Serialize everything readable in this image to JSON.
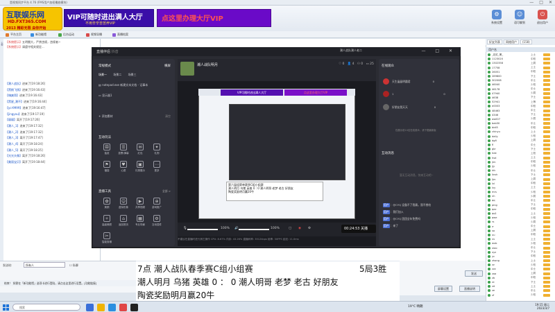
{
  "window": {
    "title": "是视频同步平台 4.76 (FMS用户加权播放模块)",
    "controls": [
      "—",
      "□",
      "✕"
    ]
  },
  "logo": {
    "line1": "互联娱乐网",
    "line2": "HD.FXT365.COM",
    "line3": "2013 精彩无限 由你开始"
  },
  "ads": {
    "ad1_main": "VIP可随时进出满人大厅",
    "ad1_sub": "不用辛辛苦苦养VIP",
    "ad2_main": "点这里办理大厅VIP",
    "ad2_sub": ""
  },
  "top_icons": [
    {
      "label": "系统设置",
      "icon": "⚙"
    },
    {
      "label": "语可聊到",
      "icon": "☺"
    },
    {
      "label": "退出用户",
      "icon": "⏻"
    }
  ],
  "toolbar": [
    "平台主页",
    "新功能馆",
    "后台运动",
    "视频导播",
    "直播档案"
  ],
  "chat_lines": [
    {
      "name": "【系统提示】",
      "text": "五明圈大，严禁违规，违规者~"
    },
    {
      "name": "【系统提示】",
      "text": "请遵守相关规定..."
    },
    {
      "name": "【潮人战队】",
      "text": "进来了[19:18:26]"
    },
    {
      "name": "【黑桃飞扬】",
      "text": "进来了[19:16:43]"
    },
    {
      "name": "【嗨爽哥】",
      "text": "进来了[19:16:43]"
    },
    {
      "name": "【黑星_潮不】",
      "text": "进来了[19:16:44]"
    },
    {
      "name": "【ycr9999】",
      "text": "进来了[19:16:47]"
    },
    {
      "name": "【jingyou】",
      "text": "进来了[19:17:19]"
    },
    {
      "name": "【弱弱】",
      "text": "离开了[19:17:26]"
    },
    {
      "name": "【潮人_1】",
      "text": "进来了[19:17:32]"
    },
    {
      "name": "【潮人_2】",
      "text": "进来了[19:17:32]"
    },
    {
      "name": "【潮人_3】",
      "text": "离开了[19:17:47]"
    },
    {
      "name": "【潮人_4】",
      "text": "离开了[19:18:24]"
    },
    {
      "name": "【潮人_5】",
      "text": "离开了[19:18:25]"
    },
    {
      "name": "【光光头像】",
      "text": "离开了[19:18:26]"
    },
    {
      "name": "【美丽宝贝】",
      "text": "离开了[19:18:44]"
    }
  ],
  "obs": {
    "title": "直播伴侣",
    "sub": "抖音",
    "user_label": "潮人战队潮人老二",
    "left": {
      "mode": "常规模式",
      "mode_side": "横屏",
      "scene_tabs": [
        "场景一",
        "场景二",
        "场景三"
      ],
      "sources": [
        "notepad.exe 新建文本文档 - 记事本",
        "显示器1"
      ],
      "add_source": "添加素材",
      "add_right": "清空",
      "section1": "互动玩法",
      "items1": [
        "抽奖",
        "投票/弹幕",
        "红包",
        "礼物",
        "福袋",
        "心愿",
        "礼物展示",
        "更多"
      ],
      "section2": "直播工具",
      "more": "全部 >",
      "items2": [
        "美颜",
        "虚拟形象",
        "共享视频",
        "游戏推广",
        "高级美颜",
        "返回首页",
        "专业场景",
        "互动插件",
        "智能剪辑"
      ]
    },
    "preview": {
      "name": "潮人战队明月",
      "stats": [
        "♡ 0",
        "👤 4",
        "⚇ 0",
        "▭ 25"
      ],
      "caption": [
        "第六届组第单赛季C组小组赛",
        "潮人明月 乌猪 英雄  0 : 0 潮人明哥 老梦 老古 好朋友",
        "陶瓷奖励明月赢20牛"
      ]
    },
    "controls": {
      "mic": "100%",
      "speaker": "100%",
      "timer": "00:24:53 关播"
    },
    "status": "不建议在直播时进行其它操作     CPU: 8.67%   内存: 43.26%   直播码率: 3512kbps   帧率: 30FPS   延迟: 11.0ms",
    "right": {
      "online_title": "在线观众",
      "online_users": [
        {
          "name": "天生晶晶明圆君",
          "score": "0"
        },
        {
          "name": "1",
          "score": "0"
        },
        {
          "name": "好朋友我天天",
          "score": "0"
        }
      ],
      "online_note": "仅展示前10名在线观众，请下载最新版",
      "interact_title": "互动消息",
      "empty": "暂无互动消息，快来互动吧~",
      "msgs": [
        {
          "tag": "用户",
          "text": "：@CYQ 设备不了我康。我不想给"
        },
        {
          "tag": "用户",
          "text": "：我们加入"
        },
        {
          "tag": "用户",
          "text": "：@CYQ 团团全年免费吗"
        },
        {
          "tag": "用户",
          "text": "：来了"
        }
      ]
    }
  },
  "overlay": {
    "line1": "7点          潮人战队春季赛C组小组赛",
    "line1b": "5局3胜",
    "line2": "潮人明月 乌猪 英雄  0 ：  0  潮人明哥 老梦 老古 好朋友",
    "line3": "陶瓷奖励明月赢20牛"
  },
  "input": {
    "label": "发送给:",
    "value": "所有人",
    "chk": "私聊",
    "hint": "结束！ 如需在「新功能馆」选项卡进行登陆，请点击这里进行设置。[功能链接]",
    "send": "发送"
  },
  "bottom_buttons": [
    "屏幕设置",
    "直播说明"
  ],
  "right_tabs": [
    "好友列表",
    "网络用户",
    "(158)"
  ],
  "right_head": "用户名",
  "users": [
    {
      "n": "_花红_黑_",
      "l": "上士"
    },
    {
      "n": "1123020",
      "l": "中校"
    },
    {
      "n": "1302358",
      "l": "上尉"
    },
    {
      "n": "17758",
      "l": "上士"
    },
    {
      "n": "26051",
      "l": "中校"
    },
    {
      "n": "289800",
      "l": "下士"
    },
    {
      "n": "302008",
      "l": "中士"
    },
    {
      "n": "46040",
      "l": "少校"
    },
    {
      "n": "46178",
      "l": "中士"
    },
    {
      "n": "47940",
      "l": "少尉"
    },
    {
      "n": "4638",
      "l": "下士"
    },
    {
      "n": "52941",
      "l": "上等"
    },
    {
      "n": "e0003",
      "l": "中校"
    },
    {
      "n": "48463",
      "l": "中士"
    },
    {
      "n": "4346",
      "l": "下士"
    },
    {
      "n": "aw007",
      "l": "少尉"
    },
    {
      "n": "bab30",
      "l": "中士"
    },
    {
      "n": "bidi5",
      "l": "中校"
    },
    {
      "n": "chinyu",
      "l": "上士"
    },
    {
      "n": "daily",
      "l": "少校"
    },
    {
      "n": "dgfi",
      "l": "上尉"
    },
    {
      "n": "fl",
      "l": "中士"
    },
    {
      "n": "gkr",
      "l": "下士"
    },
    {
      "n": "hde",
      "l": "上校"
    },
    {
      "n": "hsd",
      "l": "上士"
    },
    {
      "n": "jim",
      "l": "中校"
    },
    {
      "n": "jjy",
      "l": "少校"
    },
    {
      "n": "kfc",
      "l": "中士"
    },
    {
      "n": "linsh",
      "l": "下士"
    },
    {
      "n": "ljm",
      "l": "上尉"
    },
    {
      "n": "lvl",
      "l": "中校"
    },
    {
      "n": "lvy",
      "l": "上士"
    },
    {
      "n": "mrs",
      "l": "少校"
    },
    {
      "n": "nh",
      "l": "少尉"
    },
    {
      "n": "qq",
      "l": "中士"
    },
    {
      "n": "ping",
      "l": "下士"
    },
    {
      "n": "qaz",
      "l": "中校"
    },
    {
      "n": "qq1",
      "l": "上士"
    },
    {
      "n": "qwe",
      "l": "少校"
    },
    {
      "n": "rs",
      "l": "少尉"
    },
    {
      "n": "rr",
      "l": "中士"
    },
    {
      "n": "sa",
      "l": "上尉"
    },
    {
      "n": "uu",
      "l": "中校"
    },
    {
      "n": "vv",
      "l": "上士"
    },
    {
      "n": "wxb",
      "l": "少校"
    },
    {
      "n": "xiao",
      "l": "中士"
    },
    {
      "n": "xyz",
      "l": "下士"
    },
    {
      "n": "yc",
      "l": "中校"
    },
    {
      "n": "zhong",
      "l": "上士"
    },
    {
      "n": "zz",
      "l": "少校"
    },
    {
      "n": "zzz",
      "l": "中士"
    },
    {
      "n": "zaa",
      "l": "上尉"
    },
    {
      "n": "zb",
      "l": "中校"
    },
    {
      "n": "zc",
      "l": "下士"
    },
    {
      "n": "zd",
      "l": "上士"
    },
    {
      "n": "ze",
      "l": "中士"
    },
    {
      "n": "zf",
      "l": "少校"
    }
  ],
  "taskbar": {
    "search": "搜索",
    "weather": "19°C 晴朗",
    "time": "19:15 周二",
    "date": "2023/3/7"
  }
}
